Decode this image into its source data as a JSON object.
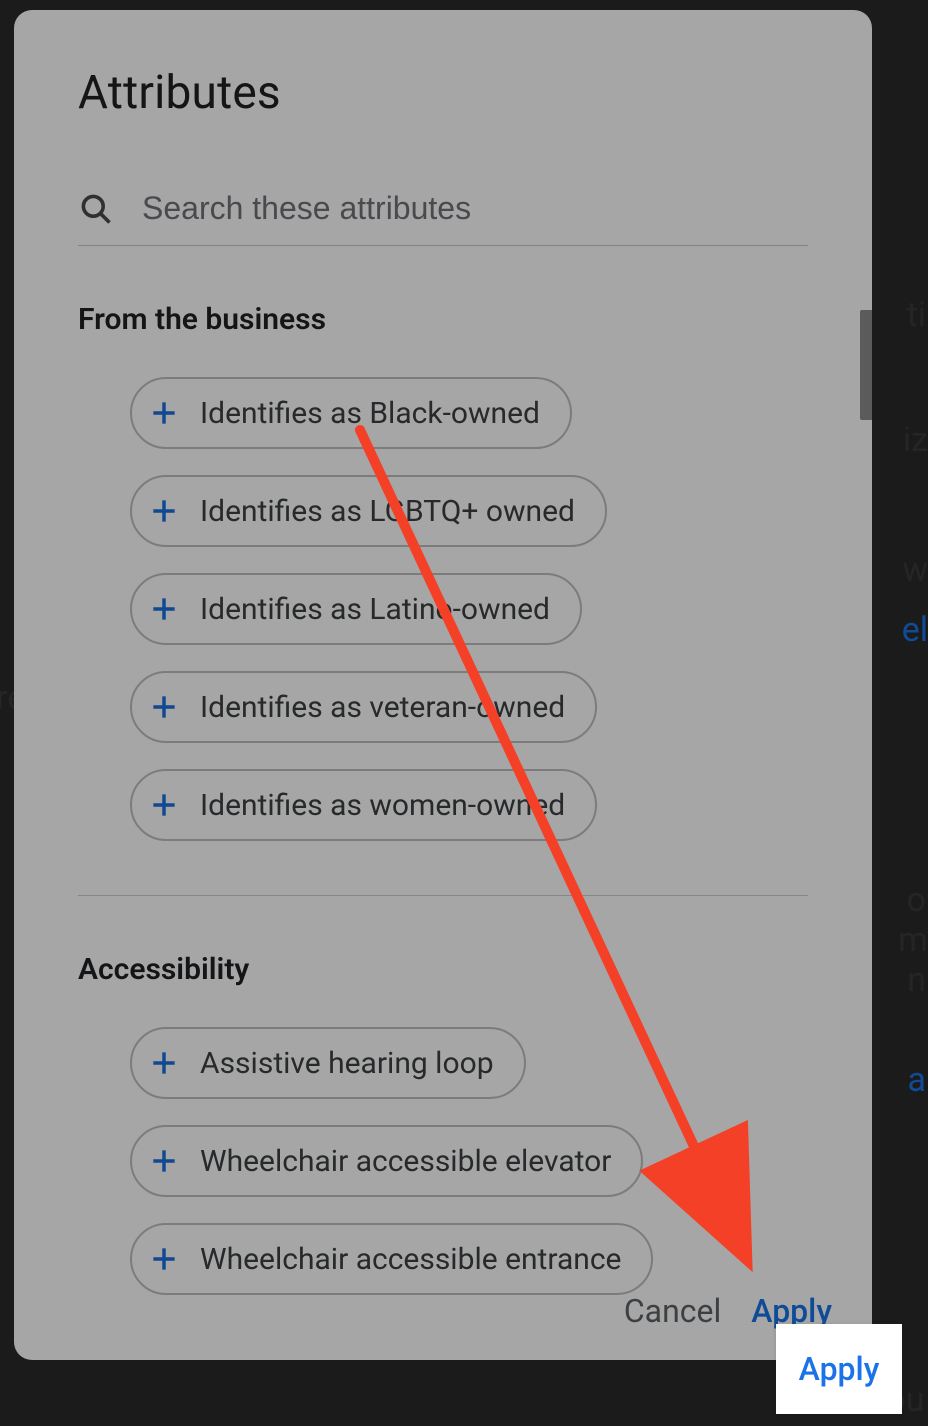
{
  "modal": {
    "title": "Attributes",
    "search": {
      "placeholder": "Search these attributes"
    },
    "sections": [
      {
        "title": "From the business",
        "chips": [
          "Identifies as Black-owned",
          "Identifies as LGBTQ+ owned",
          "Identifies as Latino-owned",
          "Identifies as veteran-owned",
          "Identifies as women-owned"
        ]
      },
      {
        "title": "Accessibility",
        "chips": [
          "Assistive hearing loop",
          "Wheelchair accessible elevator",
          "Wheelchair accessible entrance"
        ]
      }
    ],
    "buttons": {
      "cancel": "Cancel",
      "apply": "Apply"
    }
  },
  "annotation": {
    "arrow_color": "#f44027"
  },
  "icons": {
    "search": "search-icon",
    "plus": "plus-icon"
  },
  "colors": {
    "accent": "#1a73e8",
    "text": "#202124",
    "muted": "#5f6368"
  },
  "bg_frags": [
    "ti",
    "iz",
    "w",
    "el",
    "re",
    "o",
    "m",
    "n",
    "a",
    "You can"
  ]
}
